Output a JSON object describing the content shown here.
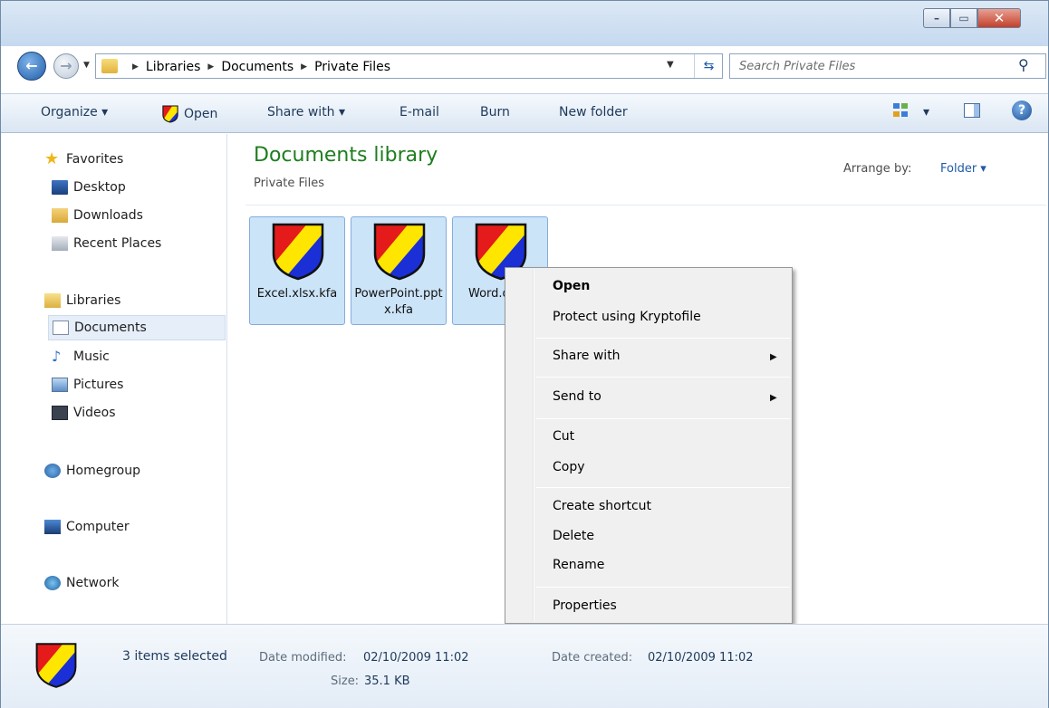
{
  "window": {
    "controls": {
      "minimize": "–",
      "maximize": "▭",
      "close": "✕"
    }
  },
  "nav": {
    "back_glyph": "←",
    "forward_glyph": "→",
    "recent_glyph": "▼"
  },
  "address": {
    "breadcrumbs": [
      "Libraries",
      "Documents",
      "Private Files"
    ],
    "sep_glyph": "▶",
    "dropdown_glyph": "▼",
    "refresh_glyph": "⇆"
  },
  "search": {
    "placeholder": "Search Private Files",
    "icon_glyph": "⚲"
  },
  "toolbar": {
    "organize": "Organize ▾",
    "open": "Open",
    "share_with": "Share with ▾",
    "email": "E-mail",
    "burn": "Burn",
    "new_folder": "New folder",
    "view_dropdown": "▾",
    "help": "?"
  },
  "sidebar": {
    "favorites": {
      "label": "Favorites",
      "items": [
        "Desktop",
        "Downloads",
        "Recent Places"
      ]
    },
    "libraries": {
      "label": "Libraries",
      "items": [
        "Documents",
        "Music",
        "Pictures",
        "Videos"
      ]
    },
    "homegroup": "Homegroup",
    "computer": "Computer",
    "network": "Network",
    "music_glyph": "♪",
    "star_glyph": "★"
  },
  "content": {
    "title": "Documents library",
    "subtitle": "Private Files",
    "arrange_label": "Arrange by:",
    "arrange_value": "Folder ▾",
    "files": [
      {
        "name": "Excel.xlsx.kfa"
      },
      {
        "name": "PowerPoint.pptx.kfa"
      },
      {
        "name": "Word.d kfa"
      }
    ]
  },
  "context_menu": {
    "items": [
      "Open",
      "Protect using Kryptofile",
      "Share with",
      "Send to",
      "Cut",
      "Copy",
      "Create shortcut",
      "Delete",
      "Rename",
      "Properties"
    ],
    "submenu_glyph": "▶"
  },
  "details": {
    "count": "3 items selected",
    "date_modified_label": "Date modified:",
    "date_modified": "02/10/2009 11:02",
    "size_label": "Size:",
    "size": "35.1 KB",
    "date_created_label": "Date created:",
    "date_created": "02/10/2009 11:02"
  },
  "colors": {
    "shield_red": "#e51b1b",
    "shield_yellow": "#ffe600",
    "shield_blue": "#1a2fd6",
    "library_title": "#1e7d1e",
    "selection": "#cce4f8"
  }
}
